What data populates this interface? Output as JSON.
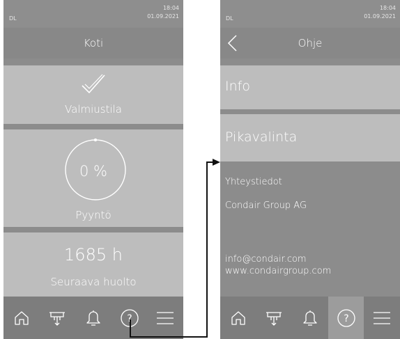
{
  "screen1": {
    "status": {
      "dl": "DL",
      "time": "18:04",
      "date": "01.09.2021"
    },
    "header": {
      "title": "Koti"
    },
    "tiles": {
      "standby": {
        "label": "Valmiustila",
        "icon": "check-icon"
      },
      "demand": {
        "value": "0 %",
        "label": "Pyyntö"
      },
      "service": {
        "value": "1685 h",
        "label": "Seuraava huolto"
      }
    }
  },
  "screen2": {
    "status": {
      "dl": "DL",
      "time": "18:04",
      "date": "01.09.2021"
    },
    "header": {
      "title": "Ohje"
    },
    "menu": [
      {
        "label": "Info"
      },
      {
        "label": "Pikavalinta"
      }
    ],
    "contact": {
      "heading": "Yhteystiedot",
      "company": "Condair Group AG",
      "email": "info@condair.com",
      "web": "www.condairgroup.com"
    }
  },
  "nav_icons": [
    "home-icon",
    "humidifier-icon",
    "bell-icon",
    "help-icon",
    "menu-icon"
  ],
  "colors": {
    "tile": "#bdbdbd",
    "background": "#8c8c8c",
    "navbar": "#7d7d7d",
    "active": "#9c9c9c",
    "arrow": "#111111"
  }
}
